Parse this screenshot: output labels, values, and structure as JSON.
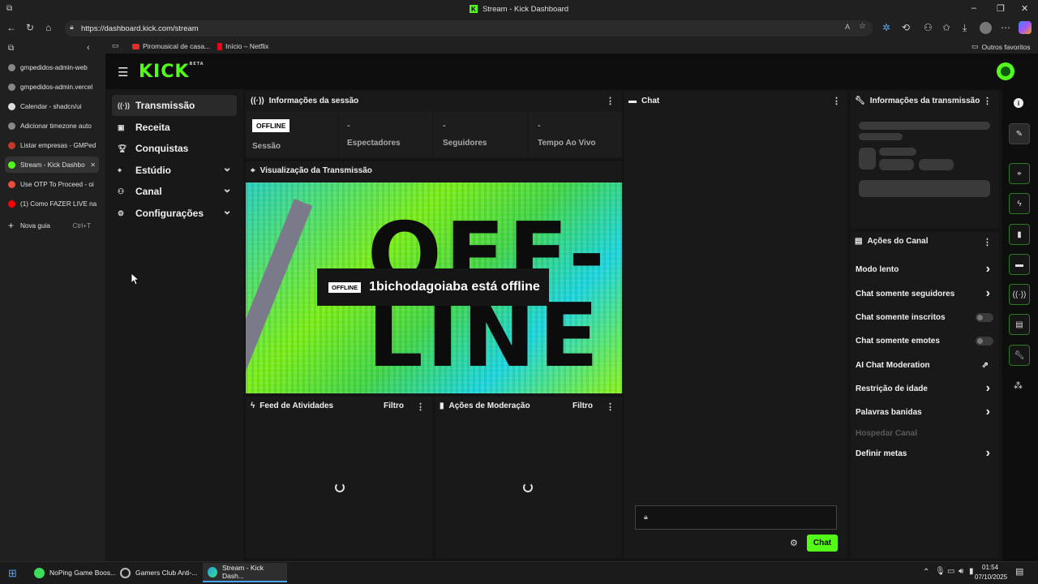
{
  "browser": {
    "window_title": "Stream - Kick Dashboard",
    "url": "https://dashboard.kick.com/stream",
    "favorites": [
      "Piromusical de casa...",
      "Início – Netflix"
    ],
    "other_favorites": "Outros favoritos"
  },
  "tabs": [
    {
      "label": "gmpedidos-admin-web",
      "color": "#888888"
    },
    {
      "label": "gmpedidos-admin.vercel",
      "color": "#888888"
    },
    {
      "label": "Calendar - shadcn/ui",
      "color": "#dddddd"
    },
    {
      "label": "Adicionar timezone auto",
      "color": "#888888"
    },
    {
      "label": "Listar empresas - GMPed",
      "color": "#c0392b"
    },
    {
      "label": "Stream - Kick Dashbo",
      "color": "#53fc18",
      "active": true
    },
    {
      "label": "Use OTP To Proceed - oi",
      "color": "#e74c3c"
    },
    {
      "label": "(1) Como FAZER LIVE na",
      "color": "#ff0000"
    }
  ],
  "new_tab": {
    "label": "Nova guia",
    "shortcut": "Ctrl+T"
  },
  "app": {
    "logo": "KICK",
    "logo_badge": "BETA",
    "nav": [
      {
        "label": "Transmissão",
        "icon": "broadcast-icon",
        "active": true
      },
      {
        "label": "Receita",
        "icon": "revenue-icon"
      },
      {
        "label": "Conquistas",
        "icon": "trophy-icon"
      },
      {
        "label": "Estúdio",
        "icon": "studio-icon",
        "expandable": true
      },
      {
        "label": "Canal",
        "icon": "channel-icon",
        "expandable": true
      },
      {
        "label": "Configurações",
        "icon": "gear-icon",
        "expandable": true
      }
    ]
  },
  "session": {
    "title": "Informações da sessão",
    "badge": "OFFLINE",
    "status_label": "Sessão",
    "stats": [
      {
        "value": "-",
        "label": "Espectadores"
      },
      {
        "value": "-",
        "label": "Seguidores"
      },
      {
        "value": "-",
        "label": "Tempo Ao Vivo"
      }
    ]
  },
  "preview": {
    "title": "Visualização da Transmissão",
    "badge": "OFFLINE",
    "message": "1bichodagoiaba está offline",
    "art_text": "OFF-LINE"
  },
  "feed": {
    "title": "Feed de Atividades",
    "filter": "Filtro"
  },
  "moderation": {
    "title": "Ações de Moderação",
    "filter": "Filtro"
  },
  "chat": {
    "title": "Chat",
    "send_label": "Chat"
  },
  "stream_info": {
    "title": "Informações da transmissão"
  },
  "channel_actions": {
    "title": "Ações do Canal",
    "items": [
      {
        "label": "Modo lento",
        "control": "chevron"
      },
      {
        "label": "Chat somente seguidores",
        "control": "chevron"
      },
      {
        "label": "Chat somente inscritos",
        "control": "toggle"
      },
      {
        "label": "Chat somente emotes",
        "control": "toggle"
      },
      {
        "label": "AI Chat Moderation",
        "control": "external"
      },
      {
        "label": "Restrição de idade",
        "control": "chevron"
      },
      {
        "label": "Palavras banidas",
        "control": "chevron"
      },
      {
        "label": "Hospedar Canal",
        "control": "none",
        "disabled": true
      },
      {
        "label": "Definir metas",
        "control": "chevron"
      }
    ]
  },
  "taskbar": {
    "apps": [
      "NoPing Game Boos...",
      "Gamers Club Anti-...",
      "Stream - Kick Dash..."
    ],
    "time": "01:54",
    "date": "07/10/2025"
  },
  "colors": {
    "accent": "#53fc18"
  }
}
